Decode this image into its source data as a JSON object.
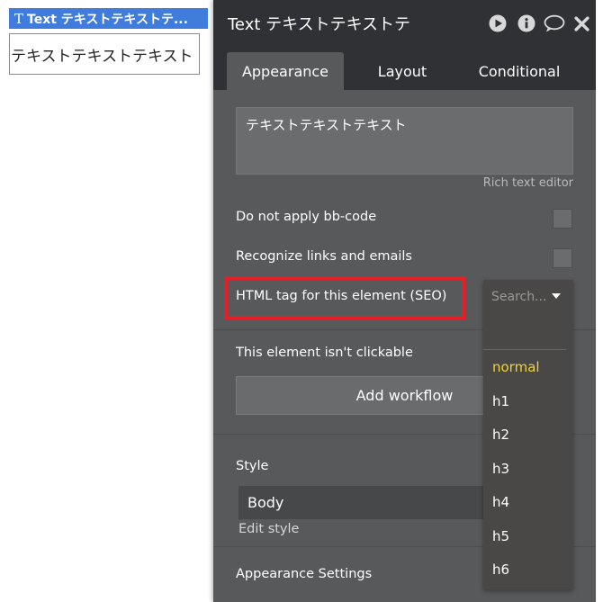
{
  "canvas": {
    "tag_icon": "T",
    "tag_label": "Text テキストテキストテ...",
    "element_text": "テキストテキストテキスト"
  },
  "panel": {
    "title": "Text テキストテキストテ",
    "icons": [
      "play-icon",
      "info-icon",
      "comment-icon",
      "close-icon"
    ],
    "tabs": [
      {
        "label": "Appearance",
        "active": true
      },
      {
        "label": "Layout",
        "active": false
      },
      {
        "label": "Conditional",
        "active": false
      }
    ],
    "text_value": "テキストテキストテキスト",
    "rich_text_editor_label": "Rich text editor",
    "do_not_apply_bbcode_label": "Do not apply bb-code",
    "recognize_links_label": "Recognize links and emails",
    "html_tag_label": "HTML tag for this element (SEO)",
    "not_clickable_label": "This element isn't clickable",
    "add_workflow_label": "Add workflow",
    "style_label": "Style",
    "style_value": "Body",
    "edit_style_label": "Edit style",
    "appearance_settings_label": "Appearance Settings"
  },
  "dropdown": {
    "placeholder": "Search...",
    "options": [
      "normal",
      "h1",
      "h2",
      "h3",
      "h4",
      "h5",
      "h6"
    ],
    "selected": "normal"
  },
  "colors": {
    "accent_blue": "#3f7cdc",
    "panel_bg": "#58595b",
    "header_bg": "#2f3134",
    "highlight_red": "#e3202a",
    "selected_yellow": "#f2d233"
  }
}
